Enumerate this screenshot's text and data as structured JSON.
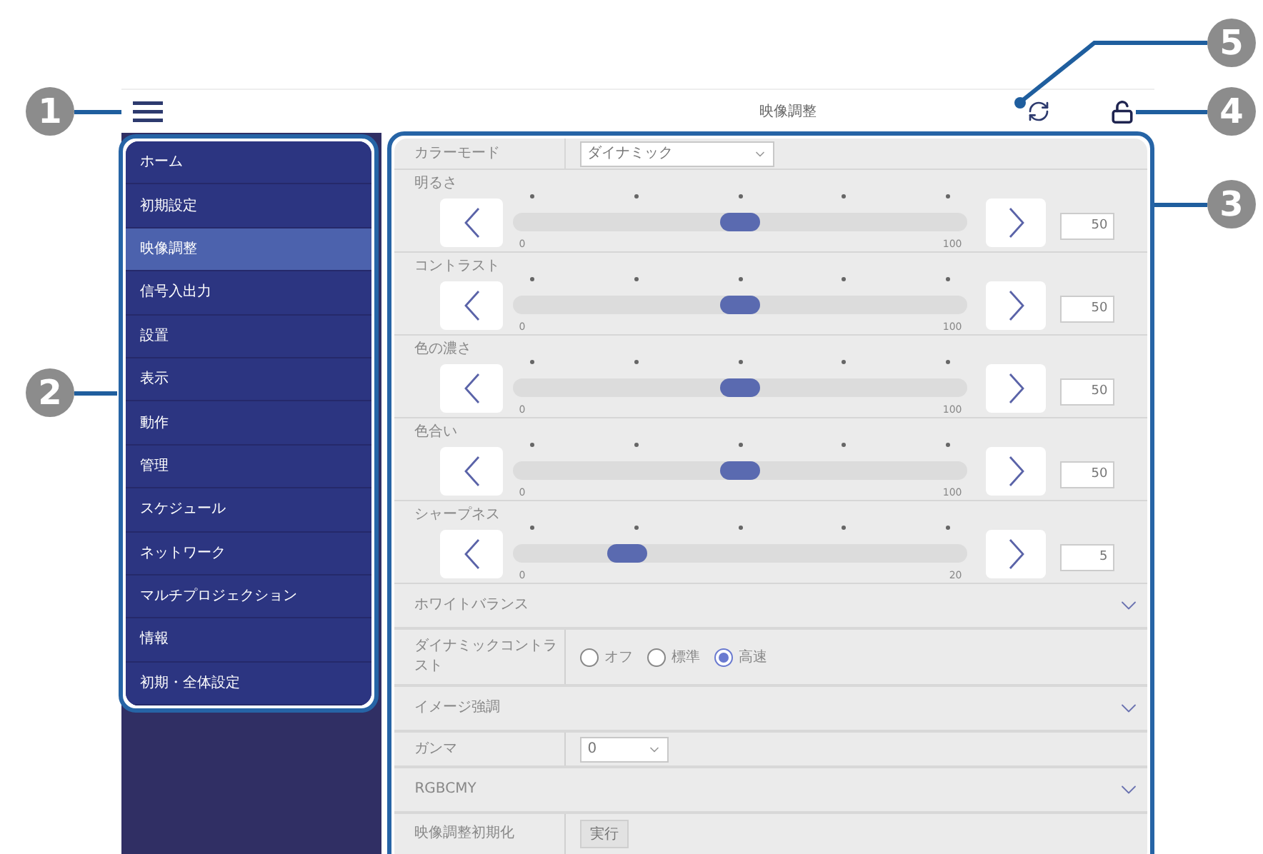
{
  "callouts": [
    {
      "number": "5"
    },
    {
      "number": "1"
    },
    {
      "number": "4"
    },
    {
      "number": "3"
    },
    {
      "number": "2"
    }
  ],
  "header": {
    "title": "映像調整"
  },
  "sidebar": {
    "items": [
      {
        "label": "ホーム",
        "selected": false
      },
      {
        "label": "初期設定",
        "selected": false
      },
      {
        "label": "映像調整",
        "selected": true
      },
      {
        "label": "信号入出力",
        "selected": false
      },
      {
        "label": "設置",
        "selected": false
      },
      {
        "label": "表示",
        "selected": false
      },
      {
        "label": "動作",
        "selected": false
      },
      {
        "label": "管理",
        "selected": false
      },
      {
        "label": "スケジュール",
        "selected": false
      },
      {
        "label": "ネットワーク",
        "selected": false
      },
      {
        "label": "マルチプロジェクション",
        "selected": false
      },
      {
        "label": "情報",
        "selected": false
      },
      {
        "label": "初期・全体設定",
        "selected": false
      }
    ]
  },
  "color_mode": {
    "label": "カラーモード",
    "value": "ダイナミック"
  },
  "sliders": [
    {
      "label": "明るさ",
      "min": "0",
      "max": "100",
      "level": 0.5,
      "value": "50"
    },
    {
      "label": "コントラスト",
      "min": "0",
      "max": "100",
      "level": 0.5,
      "value": "50"
    },
    {
      "label": "色の濃さ",
      "min": "0",
      "max": "100",
      "level": 0.5,
      "value": "50"
    },
    {
      "label": "色合い",
      "min": "0",
      "max": "100",
      "level": 0.5,
      "value": "50"
    },
    {
      "label": "シャープネス",
      "min": "0",
      "max": "20",
      "level": 0.25,
      "value": "5"
    }
  ],
  "sections": [
    {
      "kind": "expander",
      "label": "ホワイトバランス"
    },
    {
      "kind": "radio",
      "label": "ダイナミックコントラスト",
      "options": [
        {
          "label": "オフ",
          "selected": false
        },
        {
          "label": "標準",
          "selected": false
        },
        {
          "label": "高速",
          "selected": true
        }
      ]
    },
    {
      "kind": "expander",
      "label": "イメージ強調"
    },
    {
      "kind": "select",
      "label": "ガンマ",
      "value": "0"
    },
    {
      "kind": "expander",
      "label": "RGBCMY"
    },
    {
      "kind": "button",
      "label": "映像調整初期化",
      "button": "実行"
    }
  ]
}
